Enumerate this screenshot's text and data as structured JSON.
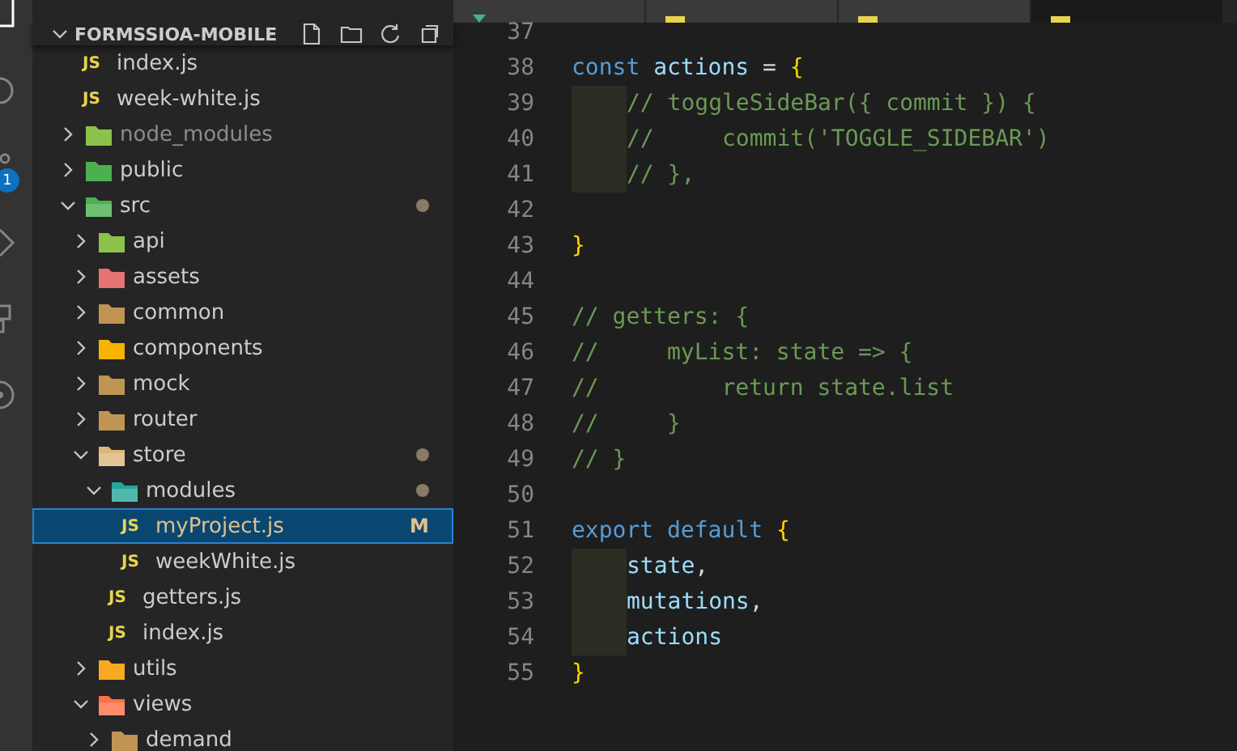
{
  "activity_bar": {
    "badge": "1"
  },
  "tabs": [
    {
      "selected": false,
      "kind": "vue"
    },
    {
      "selected": false,
      "kind": "js"
    },
    {
      "selected": false,
      "kind": "js"
    },
    {
      "selected": true,
      "kind": "js"
    }
  ],
  "explorer": {
    "title": "FORMSSIOA-MOBILE",
    "items": [
      {
        "label": "index.js",
        "kind": "file",
        "icon_text": "JS",
        "selected": false
      },
      {
        "label": "week-white.js",
        "kind": "file",
        "icon_text": "JS",
        "selected": false
      },
      {
        "label": "node_modules",
        "kind": "folder",
        "expanded": false,
        "dimmed": true,
        "color": "#8bc34a"
      },
      {
        "label": "public",
        "kind": "folder",
        "expanded": false,
        "color": "#4caf50"
      },
      {
        "label": "src",
        "kind": "folder",
        "expanded": true,
        "modified": true,
        "color": "#4caf50",
        "children": [
          {
            "label": "api",
            "kind": "folder",
            "expanded": false,
            "color": "#8bc34a"
          },
          {
            "label": "assets",
            "kind": "folder",
            "expanded": false,
            "color": "#e57373"
          },
          {
            "label": "common",
            "kind": "folder",
            "expanded": false,
            "color": "#c09553"
          },
          {
            "label": "components",
            "kind": "folder",
            "expanded": false,
            "color": "#f4b400"
          },
          {
            "label": "mock",
            "kind": "folder",
            "expanded": false,
            "color": "#c09553"
          },
          {
            "label": "router",
            "kind": "folder",
            "expanded": false,
            "color": "#c09553"
          },
          {
            "label": "store",
            "kind": "folder",
            "expanded": true,
            "modified": true,
            "color": "#dcb67a",
            "children": [
              {
                "label": "modules",
                "kind": "folder",
                "expanded": true,
                "modified": true,
                "color": "#26a69a",
                "children": [
                  {
                    "label": "myProject.js",
                    "kind": "file",
                    "icon_text": "JS",
                    "selected": true,
                    "git": "M"
                  },
                  {
                    "label": "weekWhite.js",
                    "kind": "file",
                    "icon_text": "JS",
                    "selected": false
                  }
                ]
              },
              {
                "label": "getters.js",
                "kind": "file",
                "icon_text": "JS",
                "selected": false
              },
              {
                "label": "index.js",
                "kind": "file",
                "icon_text": "JS",
                "selected": false
              }
            ]
          },
          {
            "label": "utils",
            "kind": "folder",
            "expanded": false,
            "color": "#f9a825"
          },
          {
            "label": "views",
            "kind": "folder",
            "expanded": true,
            "color": "#ff7043",
            "children": [
              {
                "label": "demand",
                "kind": "folder",
                "expanded": false,
                "color": "#c09553"
              }
            ]
          }
        ]
      }
    ]
  },
  "editor": {
    "lines": [
      {
        "number": "37"
      },
      {
        "number": "38",
        "tokens": [
          {
            "text": "const ",
            "kind": "keyword"
          },
          {
            "text": "actions",
            "kind": "variable"
          },
          {
            "text": " = ",
            "kind": "plain"
          },
          {
            "text": "{",
            "kind": "brace"
          }
        ]
      },
      {
        "number": "39",
        "indent_guide": true,
        "tokens": [
          {
            "text": "// toggleSideBar({ commit }) {",
            "kind": "comment"
          }
        ]
      },
      {
        "number": "40",
        "indent_guide": true,
        "tokens": [
          {
            "text": "//     commit('TOGGLE_SIDEBAR')",
            "kind": "comment"
          }
        ]
      },
      {
        "number": "41",
        "indent_guide": true,
        "tokens": [
          {
            "text": "// },",
            "kind": "comment"
          }
        ]
      },
      {
        "number": "42"
      },
      {
        "number": "43",
        "tokens": [
          {
            "text": "}",
            "kind": "brace"
          }
        ]
      },
      {
        "number": "44"
      },
      {
        "number": "45",
        "tokens": [
          {
            "text": "// getters: {",
            "kind": "comment"
          }
        ]
      },
      {
        "number": "46",
        "tokens": [
          {
            "text": "//     myList: state => {",
            "kind": "comment"
          }
        ]
      },
      {
        "number": "47",
        "tokens": [
          {
            "text": "//         return state.list",
            "kind": "comment"
          }
        ]
      },
      {
        "number": "48",
        "tokens": [
          {
            "text": "//     }",
            "kind": "comment"
          }
        ]
      },
      {
        "number": "49",
        "tokens": [
          {
            "text": "// }",
            "kind": "comment"
          }
        ]
      },
      {
        "number": "50"
      },
      {
        "number": "51",
        "tokens": [
          {
            "text": "export default ",
            "kind": "keyword"
          },
          {
            "text": "{",
            "kind": "brace"
          }
        ]
      },
      {
        "number": "52",
        "indent_guide": true,
        "tokens": [
          {
            "text": "state",
            "kind": "variable"
          },
          {
            "text": ",",
            "kind": "plain"
          }
        ]
      },
      {
        "number": "53",
        "indent_guide": true,
        "tokens": [
          {
            "text": "mutations",
            "kind": "variable"
          },
          {
            "text": ",",
            "kind": "plain"
          }
        ]
      },
      {
        "number": "54",
        "indent_guide": true,
        "tokens": [
          {
            "text": "actions",
            "kind": "variable"
          }
        ]
      },
      {
        "number": "55",
        "tokens": [
          {
            "text": "}",
            "kind": "brace"
          }
        ]
      }
    ]
  }
}
